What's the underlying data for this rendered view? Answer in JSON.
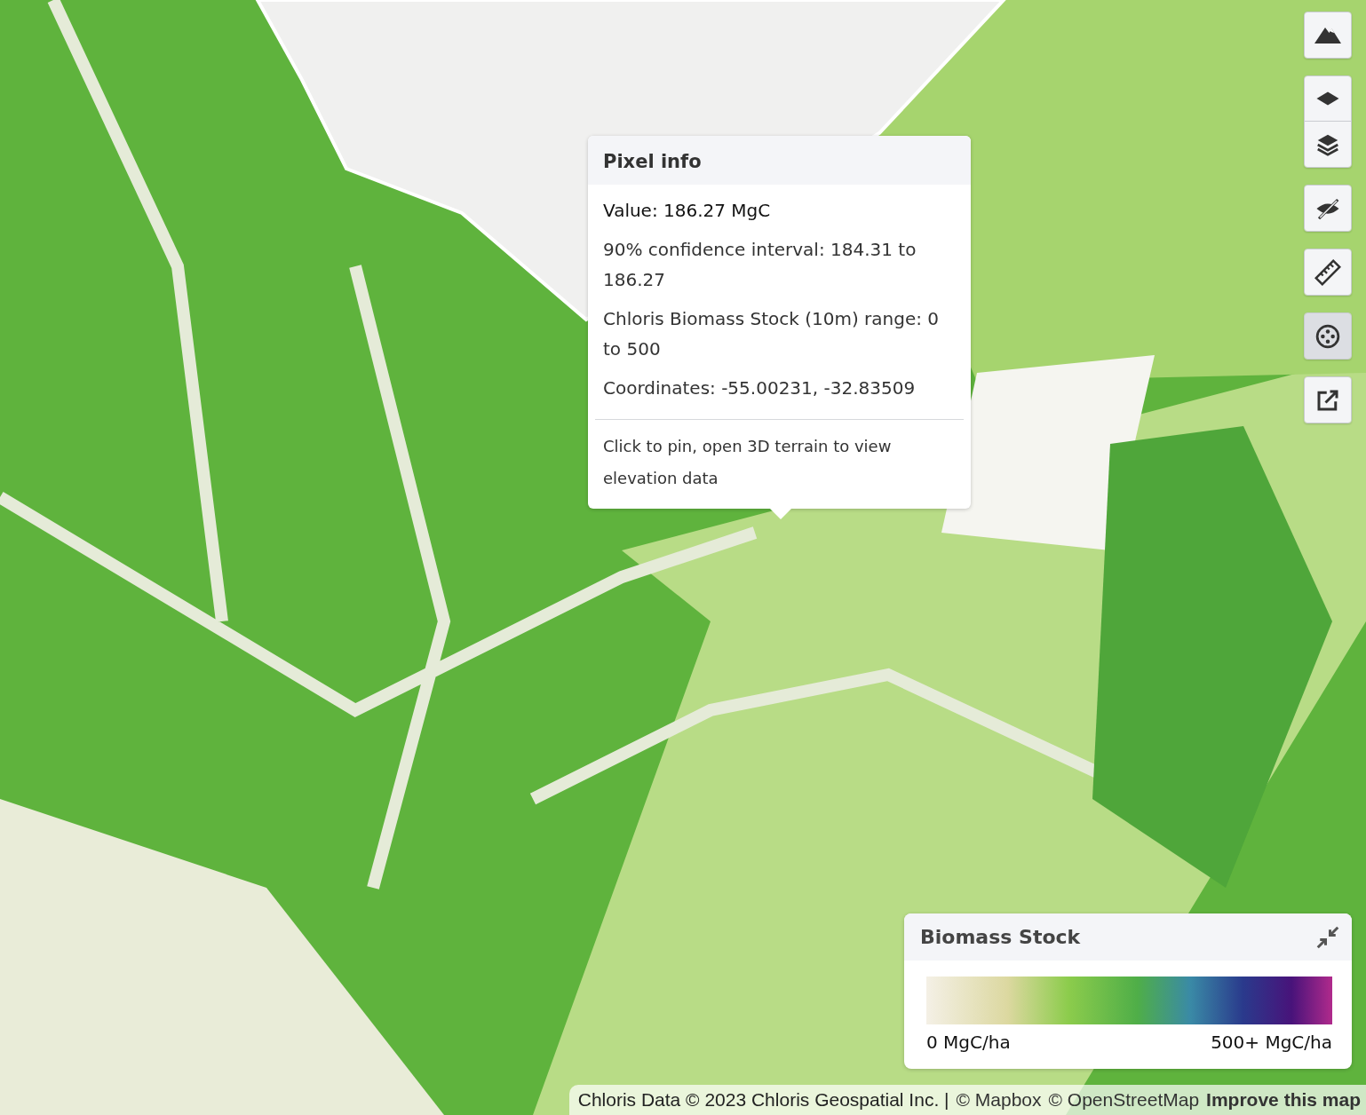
{
  "toolbar": [
    {
      "tools": [
        {
          "kind": "terrain",
          "selected": false
        }
      ]
    },
    {
      "tools": [
        {
          "kind": "layer",
          "selected": false
        },
        {
          "kind": "layers",
          "selected": false
        }
      ]
    },
    {
      "tools": [
        {
          "kind": "hide",
          "selected": false
        }
      ]
    },
    {
      "tools": [
        {
          "kind": "ruler",
          "selected": false
        }
      ]
    },
    {
      "tools": [
        {
          "kind": "crosshair",
          "selected": true
        }
      ]
    },
    {
      "tools": [
        {
          "kind": "external",
          "selected": false
        }
      ]
    }
  ],
  "popup": {
    "title": "Pixel info",
    "lines": [
      "Value: 186.27 MgC",
      "90% confidence interval: 184.31 to 186.27",
      "Chloris Biomass Stock (10m) range: 0 to 500",
      "Coordinates: -55.00231, -32.83509"
    ],
    "hint": "Click to pin, open 3D terrain to view elevation data"
  },
  "legend": {
    "title": "Biomass Stock",
    "min_label": "0 MgC/ha",
    "max_label": "500+ MgC/ha"
  },
  "attribution": {
    "text": "Chloris Data © 2023 Chloris Geospatial Inc. |",
    "links": [
      {
        "label": "© Mapbox",
        "bold": false
      },
      {
        "label": "© OpenStreetMap",
        "bold": false
      },
      {
        "label": "Improve this map",
        "bold": true
      }
    ]
  }
}
